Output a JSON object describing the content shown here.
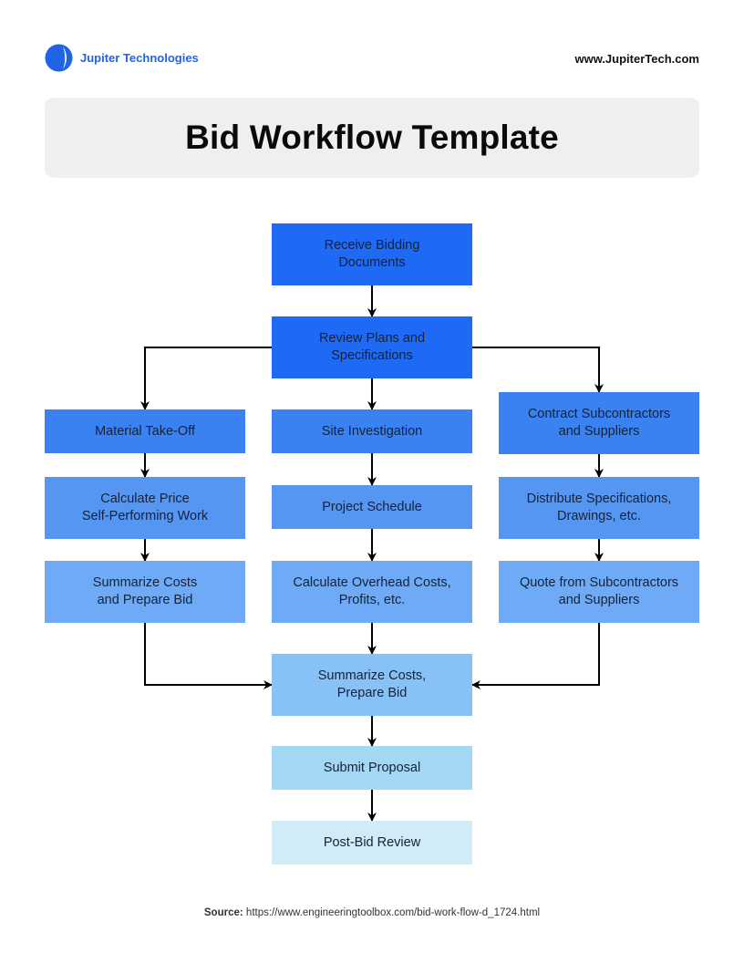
{
  "header": {
    "brand_name": "Jupiter Technologies",
    "brand_color": "#1f63e6",
    "website": "www.JupiterTech.com"
  },
  "title": "Bid Workflow Template",
  "nodes": [
    {
      "id": "receive",
      "label": "Receive Bidding\nDocuments",
      "color": "#1f6af5"
    },
    {
      "id": "review",
      "label": "Review Plans and\nSpecifications",
      "color": "#1f6af5"
    },
    {
      "id": "material",
      "label": "Material Take-Off",
      "color": "#3a82f2"
    },
    {
      "id": "site",
      "label": "Site Investigation",
      "color": "#3a82f2"
    },
    {
      "id": "contract",
      "label": "Contract Subcontractors\nand Suppliers",
      "color": "#3a82f2"
    },
    {
      "id": "calc_price",
      "label": "Calculate Price\nSelf-Performing Work",
      "color": "#5596f3"
    },
    {
      "id": "schedule",
      "label": "Project Schedule",
      "color": "#5596f3"
    },
    {
      "id": "distribute",
      "label": "Distribute Specifications,\nDrawings, etc.",
      "color": "#5596f3"
    },
    {
      "id": "summ_left",
      "label": "Summarize Costs\nand Prepare Bid",
      "color": "#6eaaf5"
    },
    {
      "id": "overhead",
      "label": "Calculate Overhead Costs,\nProfits, etc.",
      "color": "#6eaaf5"
    },
    {
      "id": "quote",
      "label": "Quote from Subcontractors\nand Suppliers",
      "color": "#6eaaf5"
    },
    {
      "id": "summ_center",
      "label": "Summarize Costs,\nPrepare Bid",
      "color": "#88c1f6"
    },
    {
      "id": "submit",
      "label": "Submit Proposal",
      "color": "#a3d7f3"
    },
    {
      "id": "postbid",
      "label": "Post-Bid Review",
      "color": "#d1ebf7"
    }
  ],
  "edges": [
    {
      "from": "receive",
      "to": "review"
    },
    {
      "from": "review",
      "to": "material"
    },
    {
      "from": "review",
      "to": "site"
    },
    {
      "from": "review",
      "to": "contract"
    },
    {
      "from": "material",
      "to": "calc_price"
    },
    {
      "from": "calc_price",
      "to": "summ_left"
    },
    {
      "from": "site",
      "to": "schedule"
    },
    {
      "from": "schedule",
      "to": "overhead"
    },
    {
      "from": "contract",
      "to": "distribute"
    },
    {
      "from": "distribute",
      "to": "quote"
    },
    {
      "from": "summ_left",
      "to": "summ_center"
    },
    {
      "from": "overhead",
      "to": "summ_center"
    },
    {
      "from": "quote",
      "to": "summ_center"
    },
    {
      "from": "summ_center",
      "to": "submit"
    },
    {
      "from": "submit",
      "to": "postbid"
    }
  ],
  "source": {
    "label": "Source:",
    "url": "https://www.engineeringtoolbox.com/bid-work-flow-d_1724.html"
  }
}
